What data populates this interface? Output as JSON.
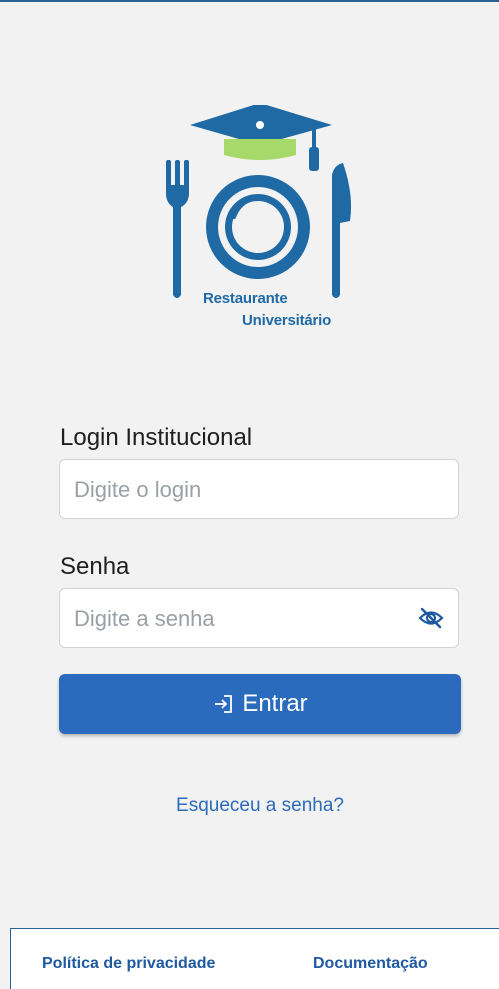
{
  "brand": {
    "line1": "Restaurante",
    "line2": "Universitário",
    "colors": {
      "primary": "#1f6aa5",
      "accent": "#a6d86a"
    }
  },
  "form": {
    "login_label": "Login Institucional",
    "login_placeholder": "Digite o login",
    "login_value": "",
    "password_label": "Senha",
    "password_placeholder": "Digite a senha",
    "password_value": "",
    "password_toggle_icon": "eye-slash-icon",
    "submit_label": "Entrar",
    "submit_icon": "login-icon",
    "forgot_label": "Esqueceu a senha?"
  },
  "footer": {
    "privacy_label": "Política de privacidade",
    "docs_label": "Documentação"
  },
  "colors": {
    "button": "#2b6bbd",
    "link": "#2b6bbd",
    "background": "#f2f2f2"
  }
}
